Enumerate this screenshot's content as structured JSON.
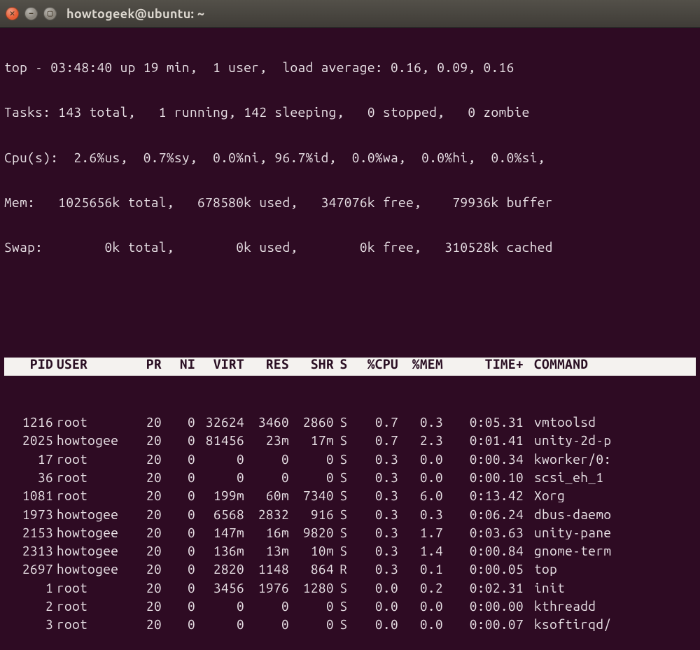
{
  "window": {
    "title": "howtogeek@ubuntu: ~"
  },
  "summary": {
    "line1": "top - 03:48:40 up 19 min,  1 user,  load average: 0.16, 0.09, 0.16",
    "line2": "Tasks: 143 total,   1 running, 142 sleeping,   0 stopped,   0 zombie",
    "line3": "Cpu(s):  2.6%us,  0.7%sy,  0.0%ni, 96.7%id,  0.0%wa,  0.0%hi,  0.0%si,",
    "line4": "Mem:   1025656k total,   678580k used,   347076k free,    79936k buffer",
    "line5": "Swap:        0k total,        0k used,        0k free,   310528k cached"
  },
  "columns": {
    "pid": "PID",
    "user": "USER",
    "pr": "PR",
    "ni": "NI",
    "virt": "VIRT",
    "res": "RES",
    "shr": "SHR",
    "s": "S",
    "cpu": "%CPU",
    "mem": "%MEM",
    "time": "TIME+",
    "cmd": "COMMAND"
  },
  "processes": [
    {
      "pid": "1216",
      "user": "root",
      "pr": "20",
      "ni": "0",
      "virt": "32624",
      "res": "3460",
      "shr": "2860",
      "s": "S",
      "cpu": "0.7",
      "mem": "0.3",
      "time": "0:05.31",
      "cmd": "vmtoolsd"
    },
    {
      "pid": "2025",
      "user": "howtogee",
      "pr": "20",
      "ni": "0",
      "virt": "81456",
      "res": "23m",
      "shr": "17m",
      "s": "S",
      "cpu": "0.7",
      "mem": "2.3",
      "time": "0:01.41",
      "cmd": "unity-2d-p"
    },
    {
      "pid": "17",
      "user": "root",
      "pr": "20",
      "ni": "0",
      "virt": "0",
      "res": "0",
      "shr": "0",
      "s": "S",
      "cpu": "0.3",
      "mem": "0.0",
      "time": "0:00.34",
      "cmd": "kworker/0:"
    },
    {
      "pid": "36",
      "user": "root",
      "pr": "20",
      "ni": "0",
      "virt": "0",
      "res": "0",
      "shr": "0",
      "s": "S",
      "cpu": "0.3",
      "mem": "0.0",
      "time": "0:00.10",
      "cmd": "scsi_eh_1"
    },
    {
      "pid": "1081",
      "user": "root",
      "pr": "20",
      "ni": "0",
      "virt": "199m",
      "res": "60m",
      "shr": "7340",
      "s": "S",
      "cpu": "0.3",
      "mem": "6.0",
      "time": "0:13.42",
      "cmd": "Xorg"
    },
    {
      "pid": "1973",
      "user": "howtogee",
      "pr": "20",
      "ni": "0",
      "virt": "6568",
      "res": "2832",
      "shr": "916",
      "s": "S",
      "cpu": "0.3",
      "mem": "0.3",
      "time": "0:06.24",
      "cmd": "dbus-daemo"
    },
    {
      "pid": "2153",
      "user": "howtogee",
      "pr": "20",
      "ni": "0",
      "virt": "147m",
      "res": "16m",
      "shr": "9820",
      "s": "S",
      "cpu": "0.3",
      "mem": "1.7",
      "time": "0:03.63",
      "cmd": "unity-pane"
    },
    {
      "pid": "2313",
      "user": "howtogee",
      "pr": "20",
      "ni": "0",
      "virt": "136m",
      "res": "13m",
      "shr": "10m",
      "s": "S",
      "cpu": "0.3",
      "mem": "1.4",
      "time": "0:00.84",
      "cmd": "gnome-term"
    },
    {
      "pid": "2697",
      "user": "howtogee",
      "pr": "20",
      "ni": "0",
      "virt": "2820",
      "res": "1148",
      "shr": "864",
      "s": "R",
      "cpu": "0.3",
      "mem": "0.1",
      "time": "0:00.05",
      "cmd": "top"
    },
    {
      "pid": "1",
      "user": "root",
      "pr": "20",
      "ni": "0",
      "virt": "3456",
      "res": "1976",
      "shr": "1280",
      "s": "S",
      "cpu": "0.0",
      "mem": "0.2",
      "time": "0:02.31",
      "cmd": "init"
    },
    {
      "pid": "2",
      "user": "root",
      "pr": "20",
      "ni": "0",
      "virt": "0",
      "res": "0",
      "shr": "0",
      "s": "S",
      "cpu": "0.0",
      "mem": "0.0",
      "time": "0:00.00",
      "cmd": "kthreadd"
    },
    {
      "pid": "3",
      "user": "root",
      "pr": "20",
      "ni": "0",
      "virt": "0",
      "res": "0",
      "shr": "0",
      "s": "S",
      "cpu": "0.0",
      "mem": "0.0",
      "time": "0:00.07",
      "cmd": "ksoftirqd/"
    }
  ]
}
